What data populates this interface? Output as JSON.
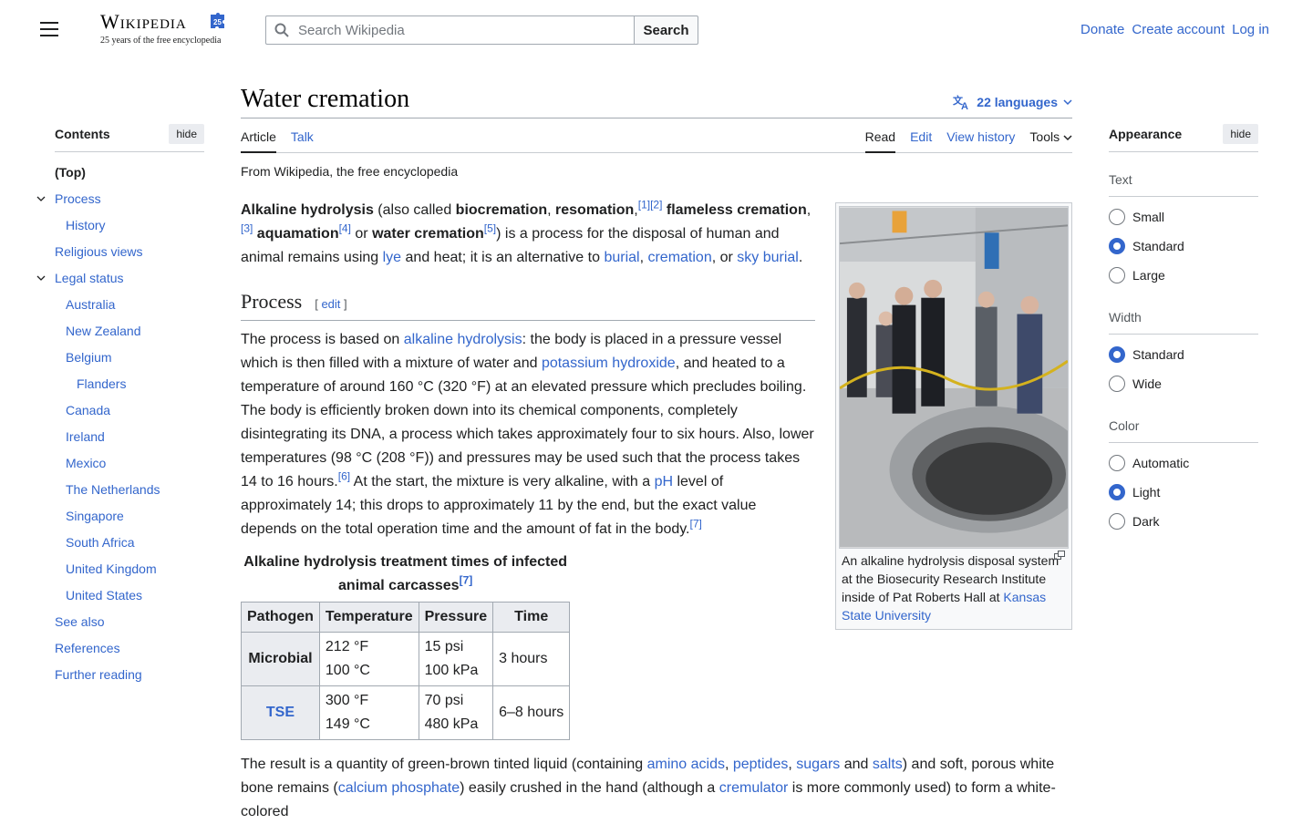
{
  "header": {
    "logo_wordmark": "Wikipedia",
    "logo_badge": "25",
    "logo_tagline": "25 years of the free encyclopedia",
    "search_placeholder": "Search Wikipedia",
    "search_button": "Search",
    "user_links": [
      "Donate",
      "Create account",
      "Log in"
    ]
  },
  "toc": {
    "title": "Contents",
    "hide_label": "hide",
    "items": [
      {
        "label": "(Top)",
        "level": 0
      },
      {
        "label": "Process",
        "level": 0,
        "expandable": true
      },
      {
        "label": "History",
        "level": 1
      },
      {
        "label": "Religious views",
        "level": 0
      },
      {
        "label": "Legal status",
        "level": 0,
        "expandable": true
      },
      {
        "label": "Australia",
        "level": 1
      },
      {
        "label": "New Zealand",
        "level": 1
      },
      {
        "label": "Belgium",
        "level": 1
      },
      {
        "label": "Flanders",
        "level": 2
      },
      {
        "label": "Canada",
        "level": 1
      },
      {
        "label": "Ireland",
        "level": 1
      },
      {
        "label": "Mexico",
        "level": 1
      },
      {
        "label": "The Netherlands",
        "level": 1
      },
      {
        "label": "Singapore",
        "level": 1
      },
      {
        "label": "South Africa",
        "level": 1
      },
      {
        "label": "United Kingdom",
        "level": 1
      },
      {
        "label": "United States",
        "level": 1
      },
      {
        "label": "See also",
        "level": 0
      },
      {
        "label": "References",
        "level": 0
      },
      {
        "label": "Further reading",
        "level": 0
      }
    ]
  },
  "article": {
    "title": "Water cremation",
    "languages_label": "22 languages",
    "tabs_left": [
      "Article",
      "Talk"
    ],
    "tabs_right": [
      "Read",
      "Edit",
      "View history",
      "Tools"
    ],
    "from_wiki": "From Wikipedia, the free encyclopedia",
    "section_process": "Process",
    "edit_label": "edit",
    "image_caption_text": "An alkaline hydrolysis disposal system at the Biosecurity Research Institute inside of Pat Roberts Hall at",
    "image_caption_link": "Kansas State University",
    "table": {
      "caption": "Alkaline hydrolysis treatment times of infected animal carcasses",
      "caption_ref": "[7]",
      "headers": [
        "Pathogen",
        "Temperature",
        "Pressure",
        "Time"
      ],
      "rows": [
        {
          "pathogen": "Microbial",
          "temp1": "212 °F",
          "temp2": "100 °C",
          "press1": "15 psi",
          "press2": "100 kPa",
          "time": "3 hours"
        },
        {
          "pathogen": "TSE",
          "temp1": "300 °F",
          "temp2": "149 °C",
          "press1": "70 psi",
          "press2": "480 kPa",
          "time": "6–8 hours"
        }
      ]
    }
  },
  "appearance": {
    "title": "Appearance",
    "hide_label": "hide",
    "groups": [
      {
        "label": "Text",
        "options": [
          "Small",
          "Standard",
          "Large"
        ],
        "selected": "Standard"
      },
      {
        "label": "Width",
        "options": [
          "Standard",
          "Wide"
        ],
        "selected": "Standard"
      },
      {
        "label": "Color",
        "options": [
          "Automatic",
          "Light",
          "Dark"
        ],
        "selected": "Light"
      }
    ]
  },
  "colors": {
    "link": "#3366cc",
    "text": "#202122",
    "border": "#a2a9b1"
  }
}
